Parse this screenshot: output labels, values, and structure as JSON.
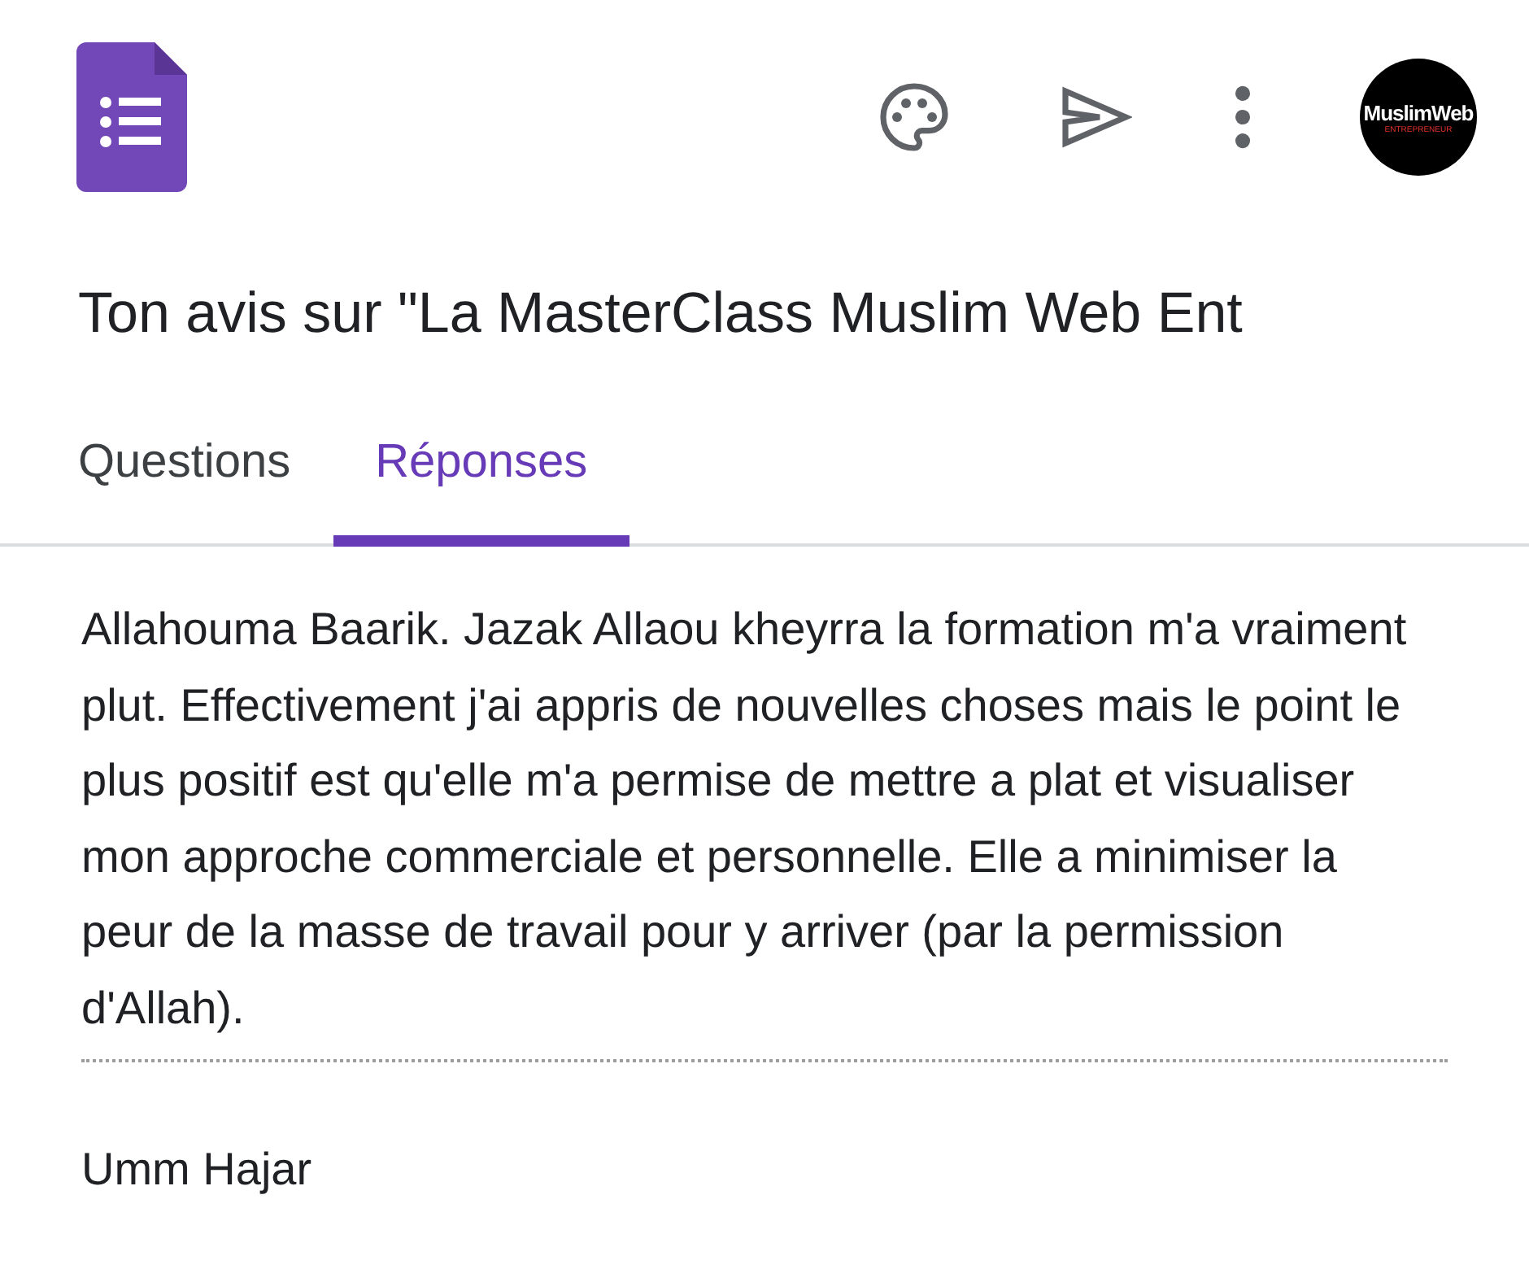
{
  "avatar": {
    "name": "MuslimWeb",
    "tagline": "ENTREPRENEUR"
  },
  "form_title": "Ton avis sur \"La MasterClass Muslim Web Ent",
  "tabs": [
    {
      "label": "Questions",
      "selected": false
    },
    {
      "label": "Réponses",
      "selected": true
    }
  ],
  "response": {
    "text": "Allahouma Baarik. Jazak Allaou kheyrra la formation m'a vraiment plut. Effectivement j'ai appris de nouvelles choses mais le point le plus positif est qu'elle m'a permise de mettre a plat et visualiser mon approche commerciale et personnelle. Elle a minimiser la peur de la masse de travail pour y arriver (par la permission d'Allah).",
    "author": "Umm Hajar"
  }
}
